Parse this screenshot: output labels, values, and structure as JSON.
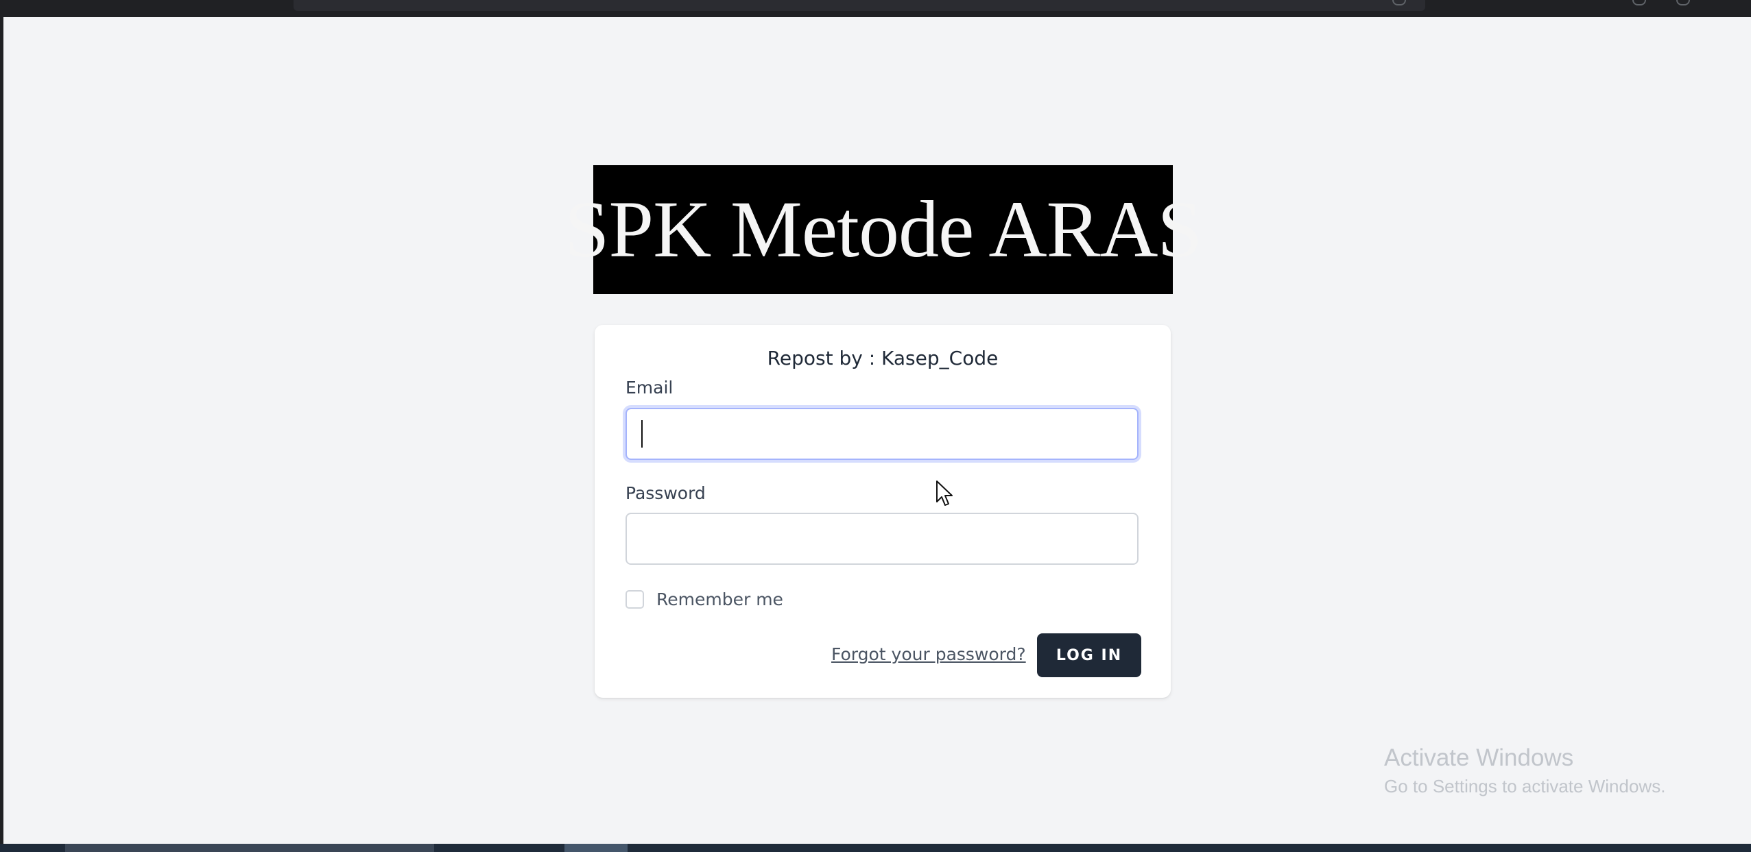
{
  "logo": {
    "text": "SPK Metode ARAS"
  },
  "login_card": {
    "title": "Repost by : Kasep_Code",
    "email_label": "Email",
    "email_value": "",
    "password_label": "Password",
    "password_value": "",
    "remember_label": "Remember me",
    "remember_checked": false,
    "forgot_link": "Forgot your password?",
    "login_button": "LOG IN"
  },
  "watermark": {
    "line1": "Activate Windows",
    "line2": "Go to Settings to activate Windows."
  },
  "colors": {
    "page_background": "#f3f4f6",
    "button_background": "#1f2937",
    "focus_ring": "#a5b4fc"
  }
}
